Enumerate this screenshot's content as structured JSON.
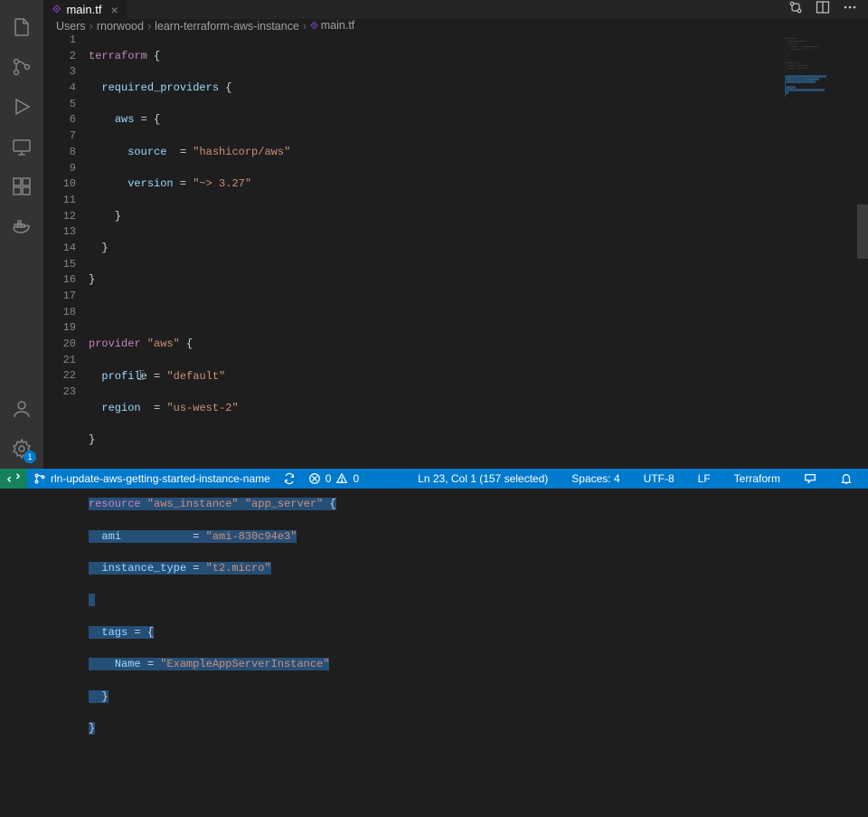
{
  "tab": {
    "filename": "main.tf"
  },
  "breadcrumbs": {
    "seg1": "Users",
    "seg2": "rnorwood",
    "seg3": "learn-terraform-aws-instance",
    "seg4": "main.tf"
  },
  "code": {
    "total_lines": 23,
    "lines": {
      "l1_kw": "terraform",
      "l1_rest": " {",
      "l2_prop": "required_providers",
      "l2_rest": " {",
      "l3_prop": "aws",
      "l3_rest": " = {",
      "l4_prop": "source",
      "l4_eq": "  = ",
      "l4_str": "\"hashicorp/aws\"",
      "l5_prop": "version",
      "l5_eq": " = ",
      "l5_str": "\"~> 3.27\"",
      "l6": "    }",
      "l7": "  }",
      "l8": "}",
      "l10_kw": "provider",
      "l10_str": " \"aws\"",
      "l10_rest": " {",
      "l11_prop": "profile",
      "l11_eq": " = ",
      "l11_str": "\"default\"",
      "l12_prop": "region",
      "l12_eq": "  = ",
      "l12_str": "\"us-west-2\"",
      "l13": "}",
      "l15_kw": "resource",
      "l15_str1": " \"aws_instance\"",
      "l15_str2": " \"app_server\"",
      "l15_rest": " {",
      "l16_prop": "ami",
      "l16_eq": "           = ",
      "l16_str": "\"ami-830c94e3\"",
      "l17_prop": "instance_type",
      "l17_eq": " = ",
      "l17_str": "\"t2.micro\"",
      "l19_prop": "tags",
      "l19_rest": " = {",
      "l20_prop": "Name",
      "l20_eq": " = ",
      "l20_str": "\"ExampleAppServerInstance\"",
      "l21": "  }",
      "l22": "}"
    }
  },
  "status": {
    "branch": "rln-update-aws-getting-started-instance-name",
    "errors": "0",
    "warnings": "0",
    "position": "Ln 23, Col 1 (157 selected)",
    "spaces": "Spaces: 4",
    "encoding": "UTF-8",
    "eol": "LF",
    "language": "Terraform"
  },
  "settings_badge": "1"
}
